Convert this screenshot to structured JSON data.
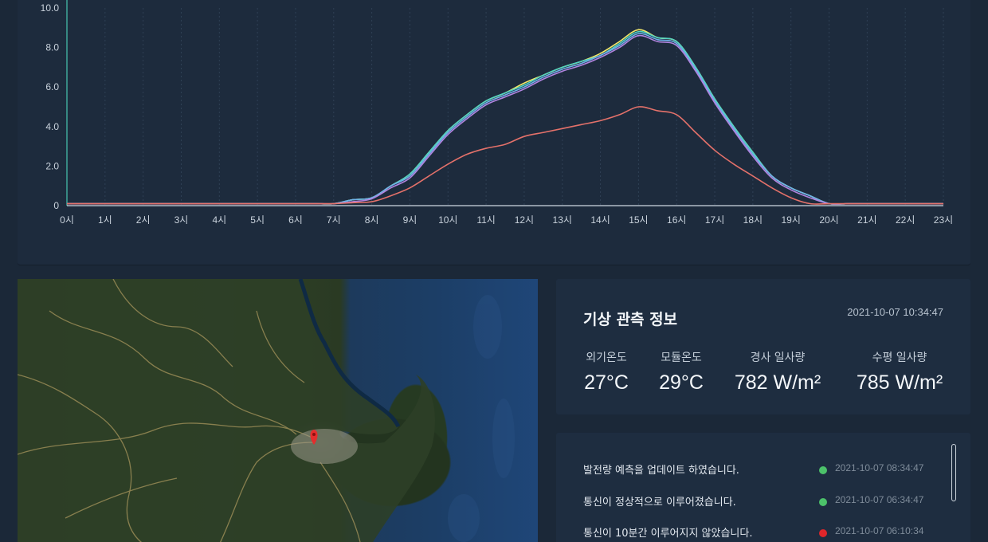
{
  "chart_data": {
    "type": "line",
    "x_labels": [
      "0시",
      "1시",
      "2시",
      "3시",
      "4시",
      "5시",
      "6시",
      "7시",
      "8시",
      "9시",
      "10시",
      "11시",
      "12시",
      "13시",
      "14시",
      "15시",
      "16시",
      "17시",
      "18시",
      "19시",
      "20시",
      "21시",
      "22시",
      "23시"
    ],
    "ylim": [
      0,
      10
    ],
    "y_ticks": [
      "0",
      "2.0",
      "4.0",
      "6.0",
      "8.0",
      "10.0"
    ],
    "x": [
      0,
      0.5,
      1,
      1.5,
      2,
      2.5,
      3,
      3.5,
      4,
      4.5,
      5,
      5.5,
      6,
      6.5,
      7,
      7.5,
      8,
      8.5,
      9,
      9.5,
      10,
      10.5,
      11,
      11.5,
      12,
      12.5,
      13,
      13.5,
      14,
      14.5,
      15,
      15.5,
      16,
      16.5,
      17,
      17.5,
      18,
      18.5,
      19,
      19.5,
      20,
      20.5,
      21,
      21.5,
      22,
      22.5,
      23
    ],
    "series": [
      {
        "color": "#f2e86a",
        "values": [
          0.1,
          0.1,
          0.1,
          0.1,
          0.1,
          0.1,
          0.1,
          0.1,
          0.1,
          0.1,
          0.1,
          0.1,
          0.1,
          0.1,
          0.1,
          0.3,
          0.4,
          1.0,
          1.6,
          2.7,
          3.8,
          4.6,
          5.3,
          5.7,
          6.2,
          6.6,
          7.0,
          7.3,
          7.7,
          8.3,
          8.9,
          8.5,
          8.3,
          7.0,
          5.4,
          4.0,
          2.7,
          1.5,
          0.9,
          0.5,
          0.1,
          0.1,
          0.1,
          0.1,
          0.1,
          0.1,
          0.1
        ]
      },
      {
        "color": "#4fd3c4",
        "values": [
          0.1,
          0.1,
          0.1,
          0.1,
          0.1,
          0.1,
          0.1,
          0.1,
          0.1,
          0.1,
          0.1,
          0.1,
          0.1,
          0.1,
          0.1,
          0.3,
          0.4,
          1.0,
          1.6,
          2.7,
          3.8,
          4.6,
          5.3,
          5.7,
          6.1,
          6.6,
          7.0,
          7.3,
          7.6,
          8.2,
          8.8,
          8.5,
          8.3,
          7.0,
          5.4,
          4.0,
          2.7,
          1.5,
          0.9,
          0.5,
          0.1,
          0.1,
          0.1,
          0.1,
          0.1,
          0.1,
          0.1
        ]
      },
      {
        "color": "#6fb0e8",
        "values": [
          0.1,
          0.1,
          0.1,
          0.1,
          0.1,
          0.1,
          0.1,
          0.1,
          0.1,
          0.1,
          0.1,
          0.1,
          0.1,
          0.1,
          0.1,
          0.3,
          0.4,
          1.0,
          1.5,
          2.6,
          3.7,
          4.5,
          5.2,
          5.6,
          6.0,
          6.5,
          6.9,
          7.2,
          7.6,
          8.1,
          8.7,
          8.4,
          8.2,
          6.9,
          5.3,
          3.9,
          2.6,
          1.5,
          0.9,
          0.5,
          0.1,
          0.1,
          0.1,
          0.1,
          0.1,
          0.1,
          0.1
        ]
      },
      {
        "color": "#b184e0",
        "values": [
          0.1,
          0.1,
          0.1,
          0.1,
          0.1,
          0.1,
          0.1,
          0.1,
          0.1,
          0.1,
          0.1,
          0.1,
          0.1,
          0.1,
          0.1,
          0.2,
          0.35,
          0.9,
          1.4,
          2.5,
          3.6,
          4.4,
          5.1,
          5.5,
          5.9,
          6.4,
          6.8,
          7.1,
          7.5,
          8.0,
          8.6,
          8.3,
          8.1,
          6.8,
          5.2,
          3.8,
          2.5,
          1.4,
          0.8,
          0.4,
          0.1,
          0.1,
          0.1,
          0.1,
          0.1,
          0.1,
          0.1
        ]
      },
      {
        "color": "#e4716a",
        "values": [
          0.1,
          0.1,
          0.1,
          0.1,
          0.1,
          0.1,
          0.1,
          0.1,
          0.1,
          0.1,
          0.1,
          0.1,
          0.1,
          0.1,
          0.1,
          0.15,
          0.2,
          0.5,
          0.9,
          1.5,
          2.1,
          2.6,
          2.9,
          3.1,
          3.5,
          3.7,
          3.9,
          4.1,
          4.3,
          4.6,
          5.0,
          4.8,
          4.6,
          3.7,
          2.8,
          2.1,
          1.5,
          0.9,
          0.4,
          0.1,
          0.1,
          0.1,
          0.1,
          0.1,
          0.1,
          0.1,
          0.1
        ]
      }
    ],
    "grid": true,
    "background": "#1d2b3d"
  },
  "weather": {
    "title": "기상 관측 정보",
    "timestamp": "2021-10-07 10:34:47",
    "metrics": [
      {
        "label": "외기온도",
        "value": "27°C"
      },
      {
        "label": "모듈온도",
        "value": "29°C"
      },
      {
        "label": "경사 일사량",
        "value": "782 W/m²"
      },
      {
        "label": "수평 일사량",
        "value": "785 W/m²"
      }
    ]
  },
  "logs": [
    {
      "message": "발전량 예측을 업데이트 하였습니다.",
      "status_color": "#4cc26a",
      "time": "2021-10-07 08:34:47"
    },
    {
      "message": "통신이 정상적으로 이루어졌습니다.",
      "status_color": "#4cc26a",
      "time": "2021-10-07 06:34:47"
    },
    {
      "message": "통신이 10분간 이루어지지 않았습니다.",
      "status_color": "#e0262a",
      "time": "2021-10-07 06:10:34"
    }
  ],
  "map": {
    "marker_icon": "map-pin-icon",
    "marker_color": "#e32d2d"
  }
}
